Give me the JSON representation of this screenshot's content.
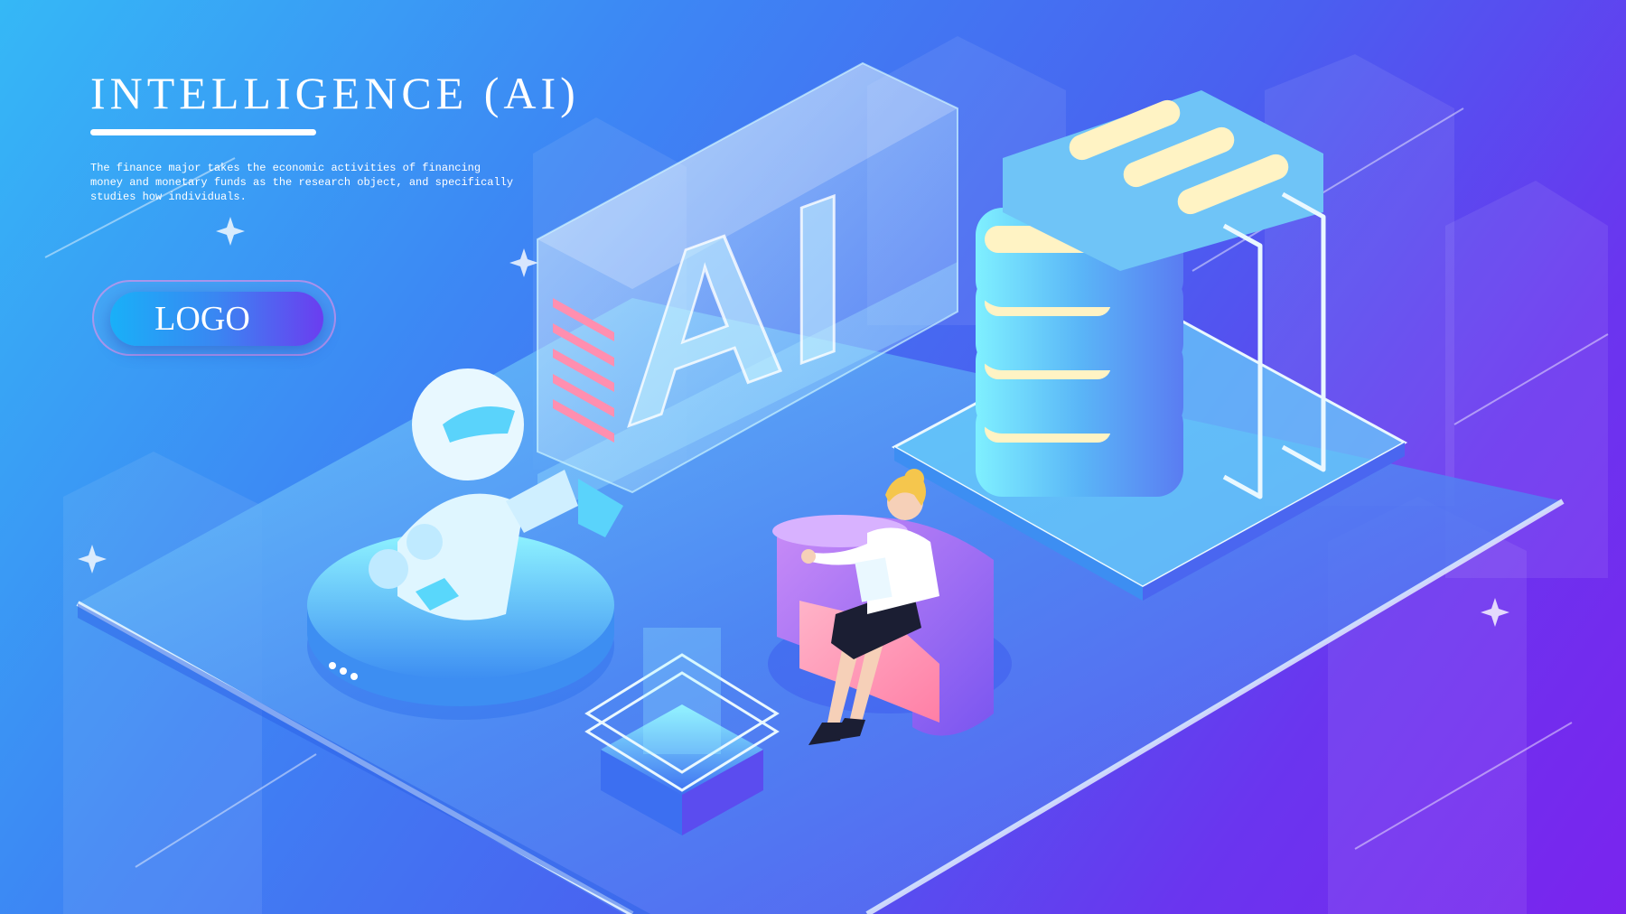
{
  "hero": {
    "title": "INTELLIGENCE (AI)",
    "description": "The finance major takes the economic activities of financing money and monetary funds as the research object, and specifically studies how individuals.",
    "logo_button_label": "LOGO"
  },
  "illustration": {
    "glass_sign_text": "AI",
    "elements": [
      "robot-arm",
      "ai-glass-sign",
      "server-rack",
      "woman-in-armchair",
      "hologram-pad"
    ]
  },
  "colors": {
    "background_start": "#35b8f6",
    "background_end": "#7a24ee",
    "accent_cyan": "#5fe3ff",
    "accent_cream": "#fff3c4",
    "accent_pink": "#ff8fb0"
  }
}
